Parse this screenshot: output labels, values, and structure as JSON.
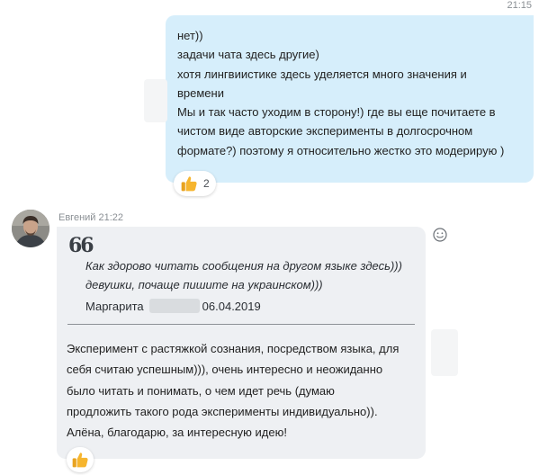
{
  "outgoing": {
    "time": "21:15",
    "lines": [
      "нет))",
      "задачи чата здесь другие)",
      "хотя лингвиистике здесь уделяется много значения и",
      "времени",
      "Мы и так часто уходим в сторону!) где вы еще почитаете в",
      "чистом виде авторские эксперименты в долгосрочном",
      "формате?) поэтому я относительно жестко это модерирую )"
    ],
    "reaction": {
      "icon": "thumbs-up-icon",
      "count": "2"
    }
  },
  "incoming": {
    "sender": "Евгений",
    "time": "21:22",
    "quote": {
      "mark": "66",
      "lines": [
        "Как здорово читать сообщения на другом языке здесь)))",
        "девушки, почаще пишите на украинском)))"
      ],
      "author": "Маргарита",
      "date": "06.04.2019"
    },
    "lines": [
      "Эксперимент с растяжкой сознания, посредством языка, для",
      "себя считаю успешным))), очень интересно и неожиданно",
      "было читать и понимать, о чем идет речь (думаю",
      "продложить такого рода эксперименты индивидуально)).",
      "Алёна, благодарю, за интересную идею!"
    ],
    "reaction": {
      "icon": "thumbs-up-icon"
    }
  },
  "colors": {
    "outgoing_bubble": "#d6eefb",
    "incoming_bubble": "#eef0f3",
    "meta_text": "#8a8f94",
    "thumb": "#f6b52e"
  }
}
